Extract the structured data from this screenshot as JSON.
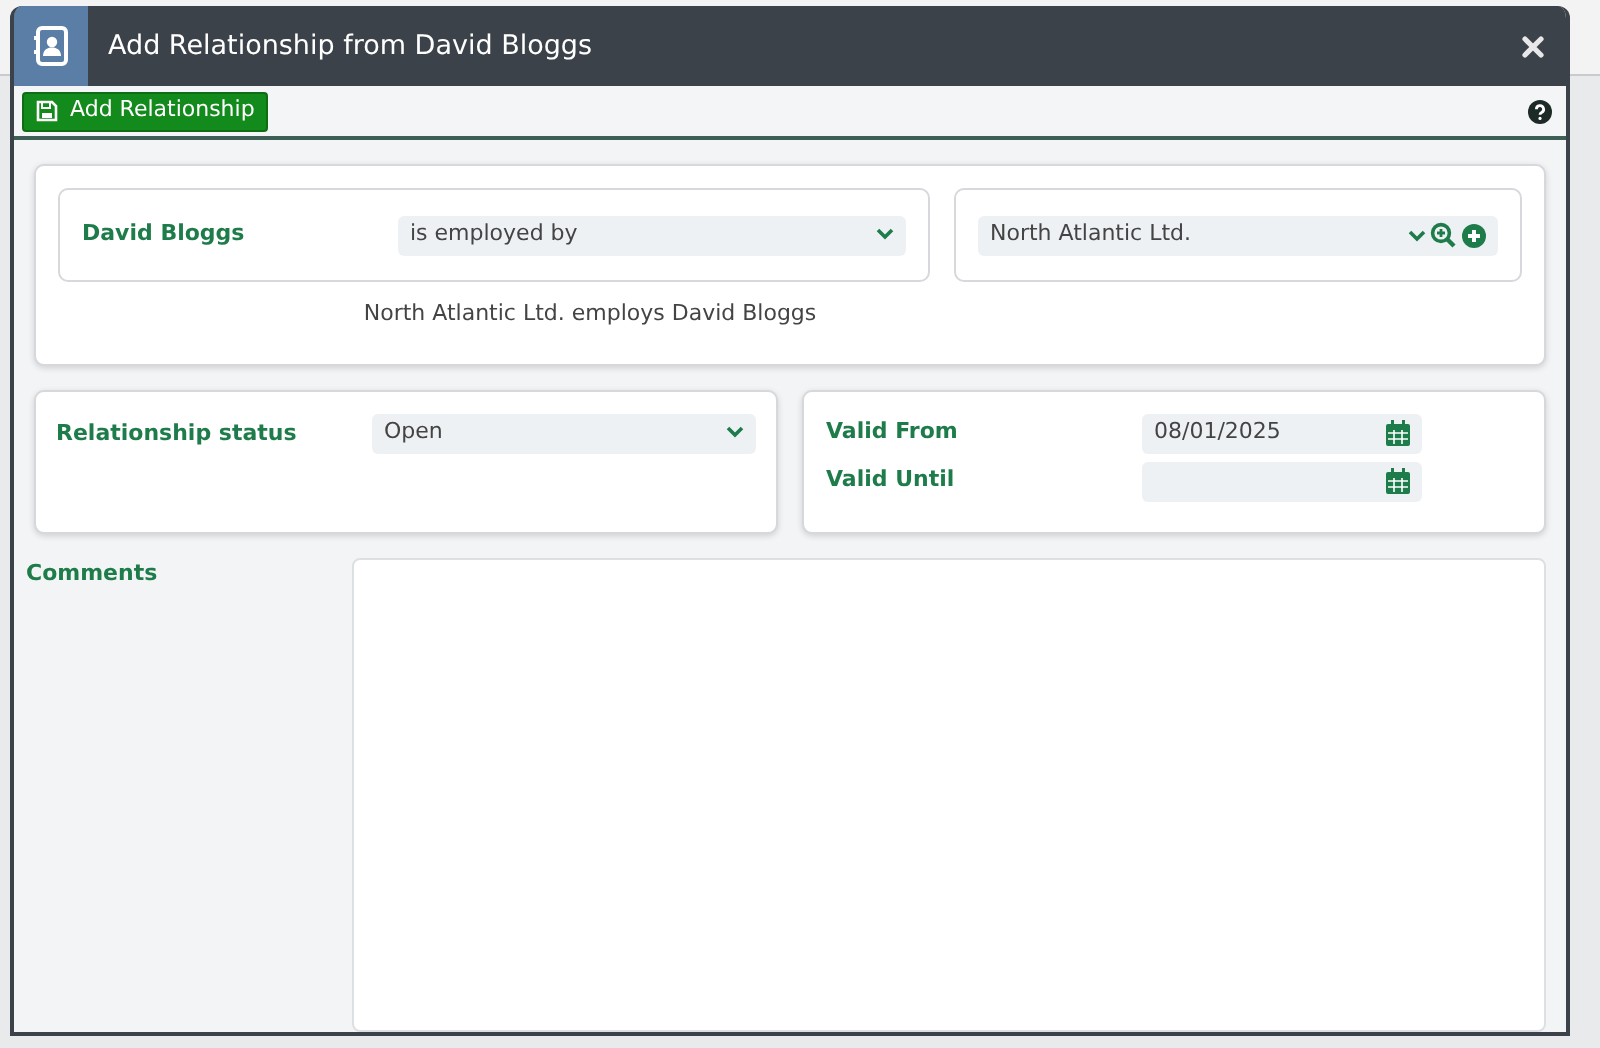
{
  "window": {
    "title": "Add Relationship from David Bloggs"
  },
  "toolbar": {
    "buttons": [
      {
        "label": "Add Relationship"
      }
    ]
  },
  "relationship": {
    "from": "David Bloggs",
    "type": "is employed by",
    "to": "North Atlantic Ltd.",
    "summary": "North Atlantic Ltd. employs David Bloggs"
  },
  "status": {
    "label": "Relationship status",
    "value": "Open"
  },
  "validity": [
    {
      "label": "Valid From",
      "value": "08/01/2025"
    },
    {
      "label": "Valid Until"
    }
  ],
  "comments": {
    "label": "Comments"
  }
}
